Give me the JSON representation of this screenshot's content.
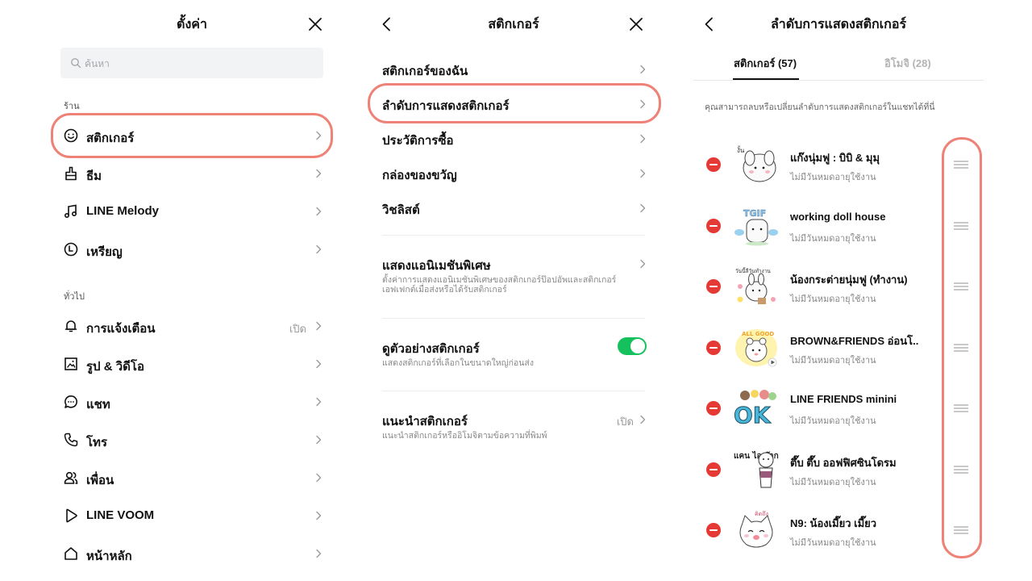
{
  "settings": {
    "title": "ตั้งค่า",
    "search_placeholder": "ค้นหา",
    "section_store": "ร้าน",
    "store_items": [
      {
        "label": "สติกเกอร์",
        "icon": "smiley-icon"
      },
      {
        "label": "ธีม",
        "icon": "brush-icon"
      },
      {
        "label": "LINE Melody",
        "icon": "music-note-icon"
      },
      {
        "label": "เหรียญ",
        "icon": "coin-icon"
      }
    ],
    "section_general": "ทั่วไป",
    "general_items": [
      {
        "label": "การแจ้งเตือน",
        "value": "เปิด",
        "icon": "bell-icon"
      },
      {
        "label": "รูป & วิดีโอ",
        "icon": "photo-icon"
      },
      {
        "label": "แชท",
        "icon": "chat-bubble-icon"
      },
      {
        "label": "โทร",
        "icon": "phone-icon"
      },
      {
        "label": "เพื่อน",
        "icon": "friends-icon"
      },
      {
        "label": "LINE VOOM",
        "icon": "voom-play-icon"
      },
      {
        "label": "หน้าหลัก",
        "icon": "home-icon"
      }
    ]
  },
  "stickers": {
    "title": "สติกเกอร์",
    "items": [
      {
        "label": "สติกเกอร์ของฉัน"
      },
      {
        "label": "ลำดับการแสดงสติกเกอร์"
      },
      {
        "label": "ประวัติการซื้อ"
      },
      {
        "label": "กล่องของขวัญ"
      },
      {
        "label": "วิชลิสต์"
      }
    ],
    "animation": {
      "label": "แสดงแอนิเมชันพิเศษ",
      "desc": "ตั้งค่าการแสดงแอนิเมชันพิเศษของสติกเกอร์ป๊อปอัพและสติกเกอร์เอฟเฟกต์เมื่อส่งหรือได้รับสติกเกอร์"
    },
    "preview": {
      "label": "ดูตัวอย่างสติกเกอร์",
      "desc": "แสดงสติกเกอร์ที่เลือกในขนาดใหญ่ก่อนส่ง",
      "enabled": true
    },
    "suggest": {
      "label": "แนะนำสติกเกอร์",
      "desc": "แนะนำสติกเกอร์หรืออิโมจิตามข้อความที่พิมพ์",
      "value": "เปิด"
    }
  },
  "order": {
    "title": "ลำดับการแสดงสติกเกอร์",
    "tab_stickers": "สติกเกอร์ (57)",
    "tab_emoji": "อิโมจิ (28)",
    "desc": "คุณสามารถลบหรือเปลี่ยนลำดับการแสดงสติกเกอร์ในแชทได้ที่นี่",
    "sticker_list": [
      {
        "name": "แก๊งนุ่มฟู : บิบิ & มุมุ",
        "sub": "ไม่มีวันหมดอายุใช้งาน",
        "thumb": "white-bunny-sticker"
      },
      {
        "name": "working doll house",
        "sub": "ไม่มีวันหมดอายุใช้งาน",
        "thumb": "tgif-doll-sticker"
      },
      {
        "name": "น้องกระต่ายนุ่มฟู (ทำงาน)",
        "sub": "ไม่มีวันหมดอายุใช้งาน",
        "thumb": "bunny-work-sticker"
      },
      {
        "name": "BROWN&FRIENDS อ่อนโ...",
        "sub": "ไม่มีวันหมดอายุใช้งาน",
        "thumb": "brown-friends-sticker"
      },
      {
        "name": "LINE FRIENDS minini",
        "sub": "ไม่มีวันหมดอายุใช้งาน",
        "thumb": "minini-ok-sticker"
      },
      {
        "name": "ตึ๊บ ตึ๊บ ออฟฟิศซินโดรม",
        "sub": "ไม่มีวันหมดอายุใช้งาน",
        "thumb": "office-syndrome-sticker"
      },
      {
        "name": "N9: น้องเมี๊ยว เมี๊ยว",
        "sub": "ไม่มีวันหมดอายุใช้งาน",
        "thumb": "cat-miss-you-sticker"
      }
    ],
    "sticker_captions": [
      "งั้น",
      "TGIF",
      "วันนี้ลีวันทำงาน",
      "ALL GOOD",
      "OK",
      "แคน ไอ อ๊าก ?",
      "คิดถึง"
    ]
  },
  "colors": {
    "highlight": "#ee8277",
    "toggle_on": "#15c15d",
    "remove": "#e53935"
  }
}
